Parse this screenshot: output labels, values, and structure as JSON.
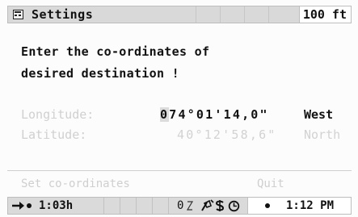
{
  "title_bar": {
    "title": "Settings",
    "distance": "100 ft"
  },
  "prompt": {
    "line1": "Enter the co-ordinates of",
    "line2": "desired destination !"
  },
  "coordinates": {
    "longitude": {
      "label": "Longitude:",
      "value_first_digit": "0",
      "value_rest": "74°01'14,0\"",
      "direction": "West"
    },
    "latitude": {
      "label": "Latitude:",
      "value": "40°12'58,6\"",
      "direction": "North"
    }
  },
  "actions": {
    "set": "Set co-ordinates",
    "quit": "Quit"
  },
  "status_bar": {
    "eta": "1:03h",
    "speed": "0",
    "clock": "1:12 PM"
  },
  "icons": {
    "title": "window-icon",
    "route": "arrow-right-dot-icon"
  }
}
